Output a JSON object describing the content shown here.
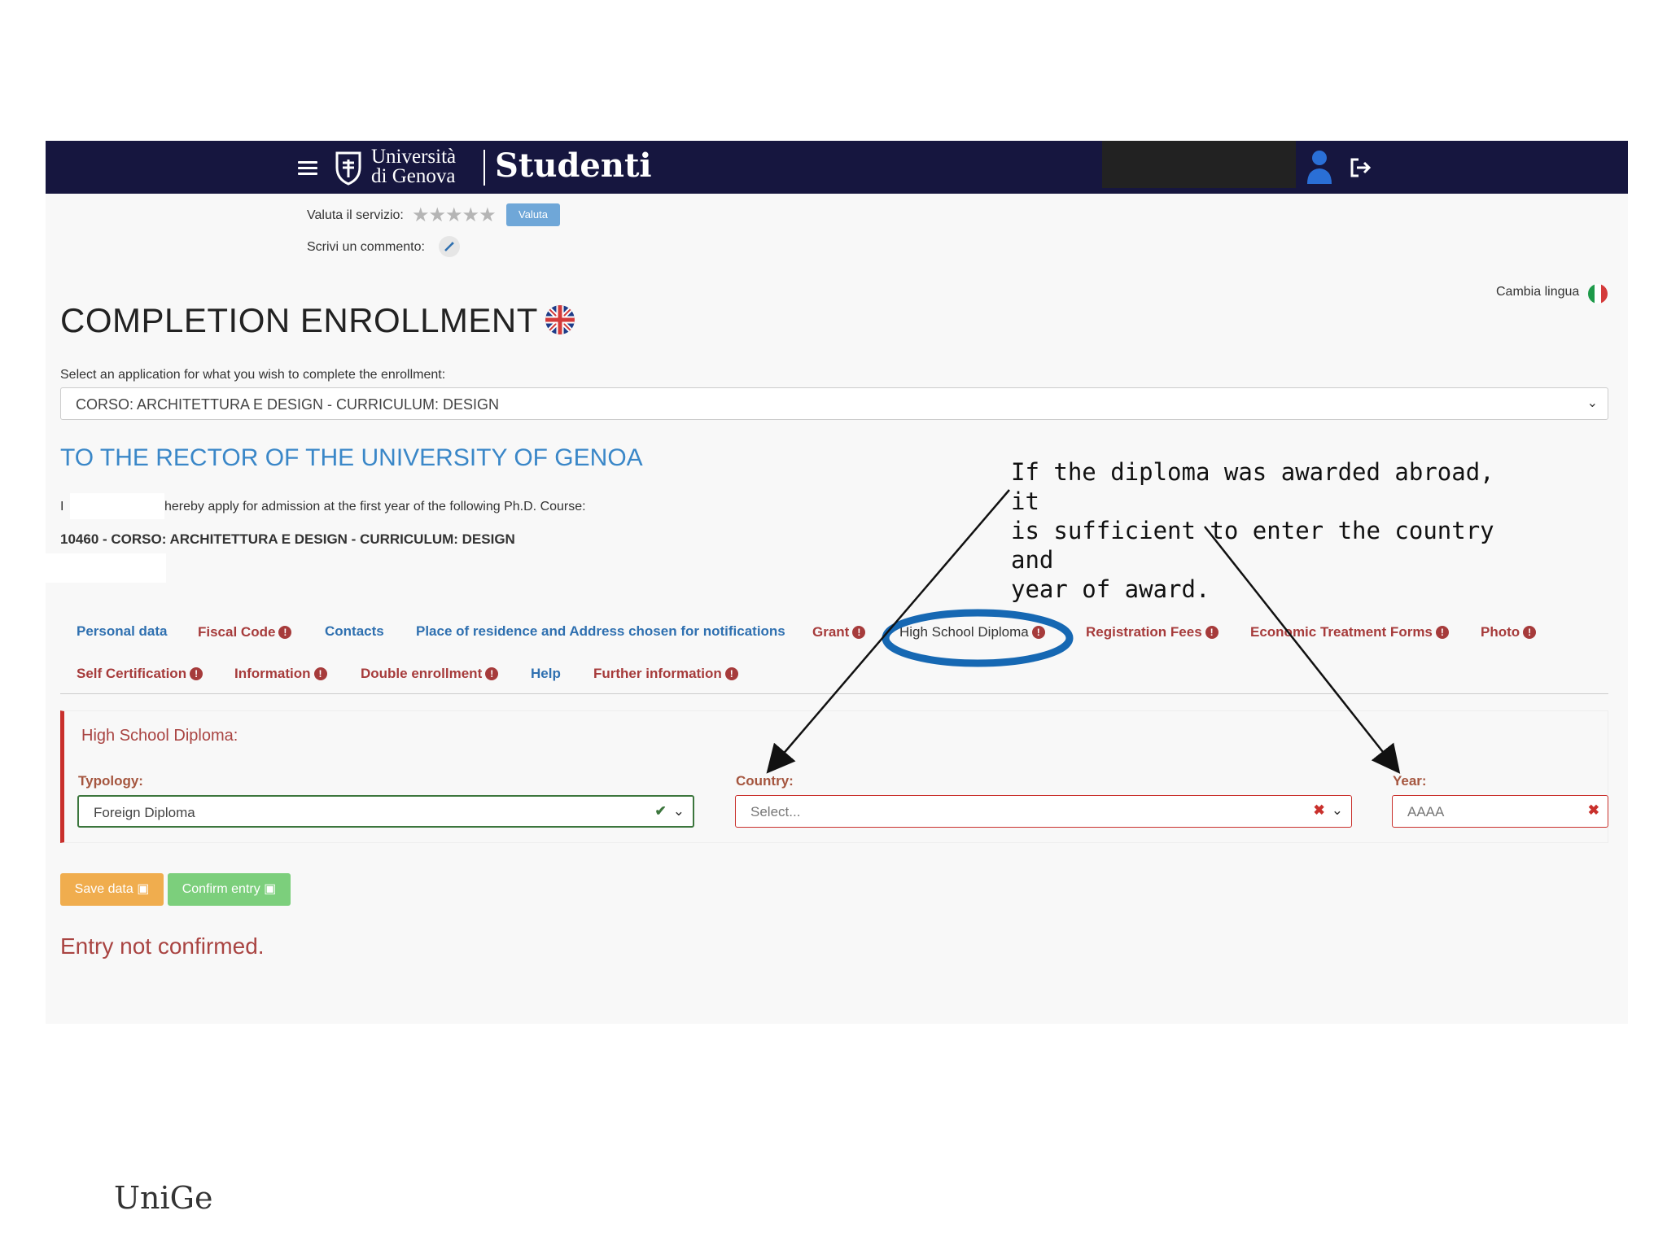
{
  "header": {
    "university_name_line1": "Università",
    "university_name_line2": "di Genova",
    "app_name": "Studenti"
  },
  "rating": {
    "label": "Valuta il servizio:",
    "stars": "★★★★★",
    "button": "Valuta",
    "comment_label": "Scrivi un commento:"
  },
  "language": {
    "label": "Cambia lingua"
  },
  "page": {
    "title": "COMPLETION ENROLLMENT",
    "select_label": "Select an application for what you wish to complete the enrollment:",
    "selected_application": "CORSO: ARCHITETTURA E DESIGN - CURRICULUM: DESIGN",
    "rector_heading": "TO THE RECTOR OF THE UNIVERSITY OF GENOA",
    "apply_prefix": "I",
    "apply_text": "hereby apply for admission at the first year of the following Ph.D. Course:",
    "course": "10460 - CORSO: ARCHITETTURA E DESIGN - CURRICULUM: DESIGN"
  },
  "tabs": [
    {
      "label": "Personal data",
      "alert": false
    },
    {
      "label": "Fiscal Code",
      "alert": true
    },
    {
      "label": "Contacts",
      "alert": false
    },
    {
      "label": "Place of residence and Address chosen for notifications",
      "alert": false
    },
    {
      "label": "Grant",
      "alert": true
    },
    {
      "label": "High School Diploma",
      "alert": true,
      "active": true
    },
    {
      "label": "Registration Fees",
      "alert": true
    },
    {
      "label": "Economic Treatment Forms",
      "alert": true
    },
    {
      "label": "Photo",
      "alert": true
    },
    {
      "label": "Self Certification",
      "alert": true
    },
    {
      "label": "Information",
      "alert": true
    },
    {
      "label": "Double enrollment",
      "alert": true
    },
    {
      "label": "Help",
      "alert": false
    },
    {
      "label": "Further information",
      "alert": true
    }
  ],
  "diploma_panel": {
    "title": "High School Diploma:",
    "typology_label": "Typology:",
    "typology_value": "Foreign Diploma",
    "country_label": "Country:",
    "country_placeholder": "Select...",
    "year_label": "Year:",
    "year_placeholder": "AAAA"
  },
  "actions": {
    "save": "Save data",
    "confirm": "Confirm entry",
    "status": "Entry not confirmed."
  },
  "annotation": {
    "text": "If the diploma was awarded abroad, it\nis sufficient to enter the country and\nyear of award."
  },
  "footer": {
    "logo_text": "UniGe"
  },
  "colors": {
    "header_bg": "#16163f",
    "link_blue": "#2f70b0",
    "alert_red": "#a63b3b",
    "highlight_ring": "#1668b3"
  }
}
